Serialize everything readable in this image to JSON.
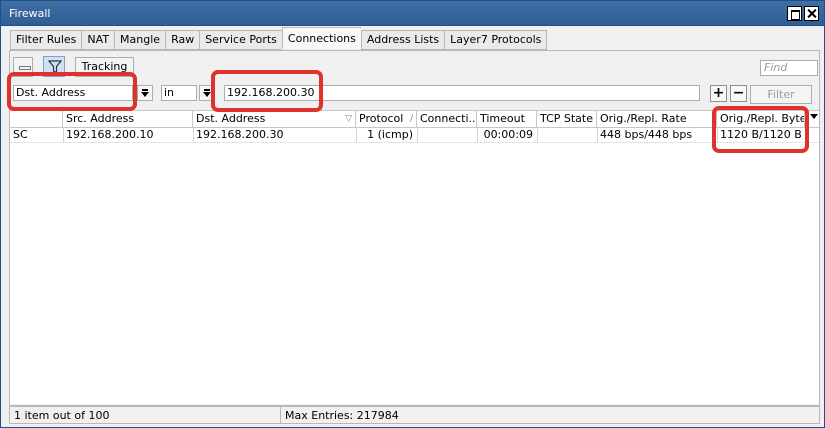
{
  "window": {
    "title": "Firewall"
  },
  "tabs": [
    "Filter Rules",
    "NAT",
    "Mangle",
    "Raw",
    "Service Ports",
    "Connections",
    "Address Lists",
    "Layer7 Protocols"
  ],
  "toolbar": {
    "tracking_label": "Tracking",
    "find_placeholder": "Find"
  },
  "filter": {
    "field": "Dst. Address",
    "operator": "in",
    "value": "192.168.200.30",
    "add_label": "+",
    "remove_label": "−",
    "filter_button": "Filter"
  },
  "columns": [
    "",
    "Src. Address",
    "Dst. Address",
    "Protocol",
    "Connecti...",
    "Timeout",
    "TCP State",
    "Orig./Repl. Rate",
    "Orig./Repl. Bytes"
  ],
  "rows": [
    {
      "flags": "SC",
      "src_address": "192.168.200.10",
      "dst_address": "192.168.200.30",
      "protocol": "1 (icmp)",
      "connection_mark": "",
      "timeout": "00:00:09",
      "tcp_state": "",
      "rate": "448 bps/448 bps",
      "bytes": "1120 B/1120 B"
    }
  ],
  "status": {
    "count": "1 item out of 100",
    "max_entries": "Max Entries: 217984"
  },
  "colors": {
    "titlebar": "#3f6fa5",
    "highlight": "#e0322c"
  }
}
